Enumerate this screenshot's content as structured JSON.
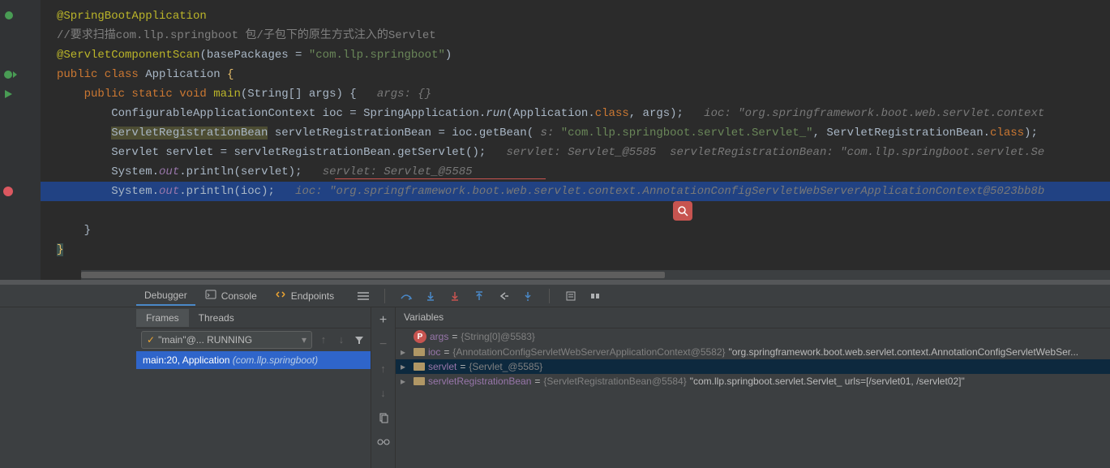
{
  "code": {
    "l1": {
      "anno": "@SpringBootApplication"
    },
    "l2": {
      "comment": "//要求扫描com.llp.springboot 包/子包下的原生方式注入的Servlet"
    },
    "l3": {
      "anno": "@ServletComponentScan",
      "p": "(basePackages = ",
      "str": "\"com.llp.springboot\"",
      "close": ")"
    },
    "l4": {
      "kw1": "public class ",
      "cls": "Application ",
      "brace": "{"
    },
    "l5": {
      "kw": "public static void ",
      "m": "main",
      "sig": "(String[] args) {   ",
      "hint": "args: {}"
    },
    "l6": {
      "a": "ConfigurableApplicationContext ioc = SpringApplication.",
      "run": "run",
      "b": "(Application.",
      "class": "class",
      "c": ", args);   ",
      "hint": "ioc: \"org.springframework.boot.web.servlet.context"
    },
    "l7": {
      "a": "ServletRegistrationBean",
      "b": " servletRegistrationBean = ioc.getBean( ",
      "np": "s: ",
      "str": "\"com.llp.springboot.servlet.Servlet_\"",
      "c": ", ServletRegistrationBean.",
      "class": "class",
      "d": ");"
    },
    "l8": {
      "a": "Servlet servlet = servletRegistrationBean.getServlet();   ",
      "hint": "servlet: Servlet_@5585  servletRegistrationBean: \"com.llp.springboot.servlet.Se"
    },
    "l9": {
      "a": "System.",
      "out": "out",
      "b": ".println(servlet);   ",
      "hint": "servlet: Servlet_@5585"
    },
    "l10": {
      "a": "System.",
      "out": "out",
      "b": ".println(ioc);   ",
      "hint": "ioc: \"org.springframework.boot.web.servlet.context.AnnotationConfigServletWebServerApplicationContext@5023bb8b"
    }
  },
  "debugger": {
    "tab_debugger": "Debugger",
    "tab_console": "Console",
    "tab_endpoints": "Endpoints",
    "frames_tab": "Frames",
    "threads_tab": "Threads",
    "thread_selector": "\"main\"@... RUNNING",
    "frame_main": "main:20, Application",
    "frame_pkg": " (com.llp.springboot)",
    "variables_header": "Variables"
  },
  "vars": {
    "args": {
      "name": "args",
      "eq": " = ",
      "type": "{String[0]@5583}"
    },
    "ioc": {
      "name": "ioc",
      "eq": " = ",
      "type": "{AnnotationConfigServletWebServerApplicationContext@5582}",
      "val": " \"org.springframework.boot.web.servlet.context.AnnotationConfigServletWebSer...  "
    },
    "servlet": {
      "name": "servlet",
      "eq": " = ",
      "type": "{Servlet_@5585}"
    },
    "srb": {
      "name": "servletRegistrationBean",
      "eq": " = ",
      "type": "{ServletRegistrationBean@5584}",
      "val": " \"com.llp.springboot.servlet.Servlet_ urls=[/servlet01, /servlet02]\""
    }
  }
}
